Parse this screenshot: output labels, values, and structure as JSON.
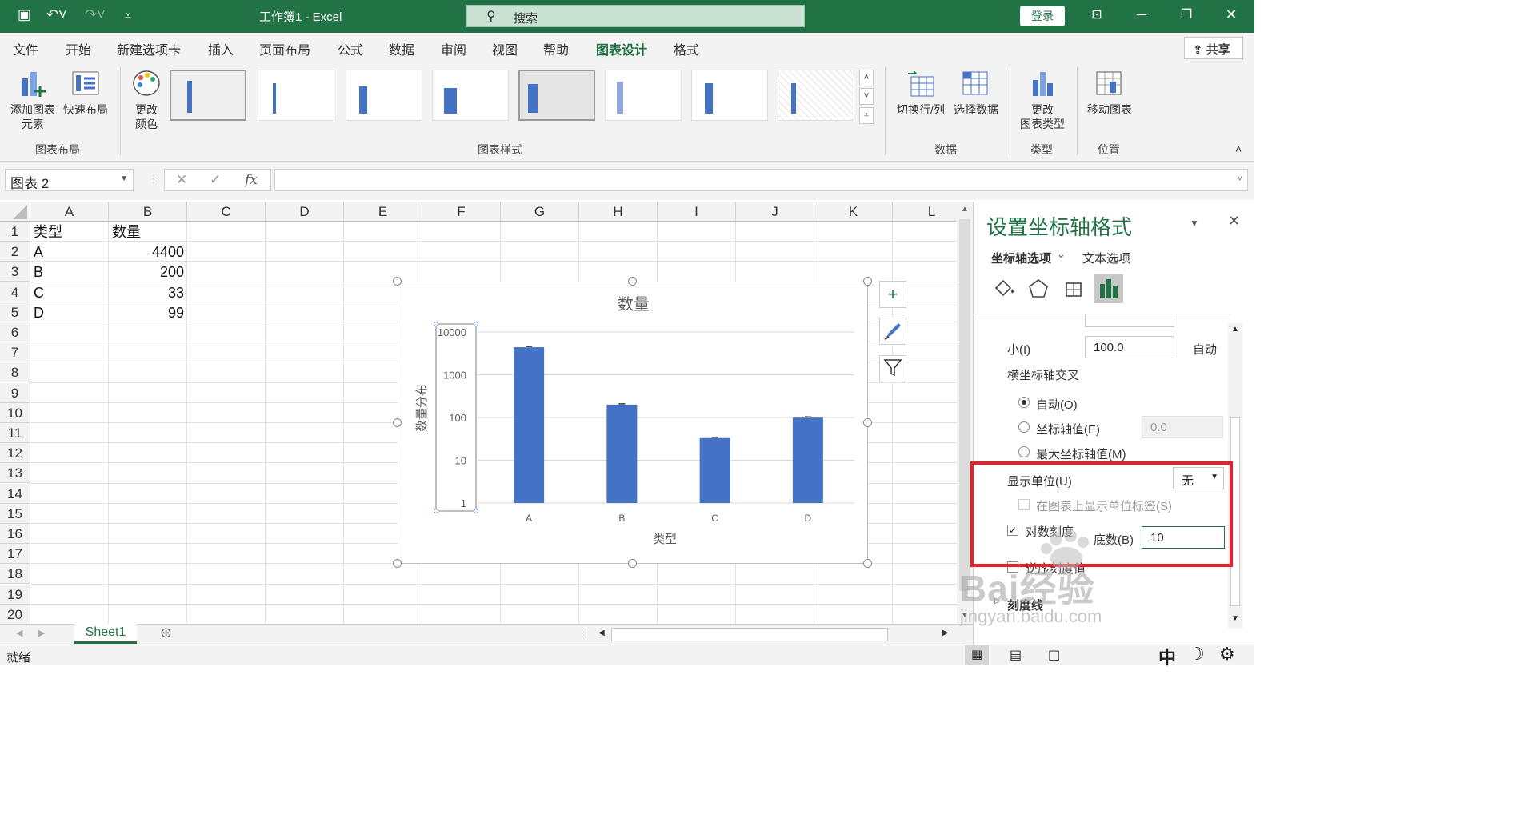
{
  "app": {
    "title": "工作簿1 - Excel",
    "search_placeholder": "搜索",
    "login": "登录"
  },
  "menu": {
    "tabs": [
      "文件",
      "开始",
      "新建选项卡",
      "插入",
      "页面布局",
      "公式",
      "数据",
      "审阅",
      "视图",
      "帮助",
      "图表设计",
      "格式"
    ],
    "active": "图表设计",
    "share": "共享"
  },
  "ribbon": {
    "add_element": "添加图表\n元素",
    "quick_layout": "快速布局",
    "change_colors": "更改\n颜色",
    "switch_row_col": "切换行/列",
    "select_data": "选择数据",
    "change_type": "更改\n图表类型",
    "move_chart": "移动图表",
    "groups": {
      "layout": "图表布局",
      "styles": "图表样式",
      "data": "数据",
      "type": "类型",
      "location": "位置"
    }
  },
  "formula": {
    "name_box": "图表 2",
    "fx": "fx"
  },
  "sheet": {
    "columns": [
      "A",
      "B",
      "C",
      "D",
      "E",
      "F",
      "G",
      "H",
      "I",
      "J",
      "K",
      "L"
    ],
    "rows": [
      "1",
      "2",
      "3",
      "4",
      "5",
      "6",
      "7",
      "8",
      "9",
      "10",
      "11",
      "12",
      "13",
      "14",
      "15",
      "16",
      "17",
      "18",
      "19",
      "20"
    ],
    "cells": [
      {
        "row": 1,
        "col": "A",
        "value": "类型",
        "align": "left"
      },
      {
        "row": 1,
        "col": "B",
        "value": "数量",
        "align": "left"
      },
      {
        "row": 2,
        "col": "A",
        "value": "A",
        "align": "left"
      },
      {
        "row": 2,
        "col": "B",
        "value": "4400",
        "align": "right"
      },
      {
        "row": 3,
        "col": "A",
        "value": "B",
        "align": "left"
      },
      {
        "row": 3,
        "col": "B",
        "value": "200",
        "align": "right"
      },
      {
        "row": 4,
        "col": "A",
        "value": "C",
        "align": "left"
      },
      {
        "row": 4,
        "col": "B",
        "value": "33",
        "align": "right"
      },
      {
        "row": 5,
        "col": "A",
        "value": "D",
        "align": "left"
      },
      {
        "row": 5,
        "col": "B",
        "value": "99",
        "align": "right"
      }
    ],
    "tab": "Sheet1"
  },
  "status": {
    "left": "就绪",
    "ime": "中"
  },
  "chart_data": {
    "type": "bar",
    "title": "数量",
    "xlabel": "类型",
    "ylabel": "数量分布",
    "categories": [
      "A",
      "B",
      "C",
      "D"
    ],
    "values": [
      4400,
      200,
      33,
      99
    ],
    "yscale": "log",
    "ylim": [
      1,
      10000
    ],
    "yticks": [
      "1",
      "10",
      "100",
      "1000",
      "10000"
    ],
    "bar_color": "#4472c4",
    "grid": true
  },
  "pane": {
    "title": "设置坐标轴格式",
    "tab_axis_options": "坐标轴选项",
    "tab_text_options": "文本选项",
    "min_label": "小(I)",
    "min_value": "100.0",
    "min_auto": "自动",
    "cross_label": "横坐标轴交叉",
    "radio_auto": "自动(O)",
    "radio_value": "坐标轴值(E)",
    "radio_value_input": "0.0",
    "radio_max": "最大坐标轴值(M)",
    "display_units_label": "显示单位(U)",
    "display_units_value": "无",
    "show_units_label": "在图表上显示单位标签(S)",
    "log_scale_label": "对数刻度",
    "base_label": "底数(B)",
    "base_value": "10",
    "reverse_label": "逆序刻度值",
    "ticks_label": "刻度线"
  },
  "watermark": {
    "brand": "Bai经验",
    "url": "jingyan.baidu.com"
  }
}
